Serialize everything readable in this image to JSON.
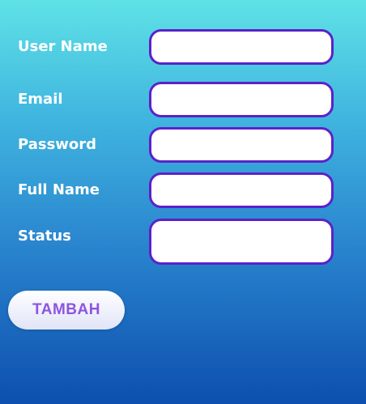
{
  "form": {
    "username": {
      "label": "User Name",
      "value": ""
    },
    "email": {
      "label": "Email",
      "value": ""
    },
    "password": {
      "label": "Password",
      "value": ""
    },
    "fullname": {
      "label": "Full Name",
      "value": ""
    },
    "status": {
      "label": "Status",
      "value": ""
    }
  },
  "actions": {
    "add_label": "TAMBAH"
  },
  "colors": {
    "field_border": "#5b22c9",
    "button_text": "#8e55e0",
    "label_text": "#ffffff"
  }
}
